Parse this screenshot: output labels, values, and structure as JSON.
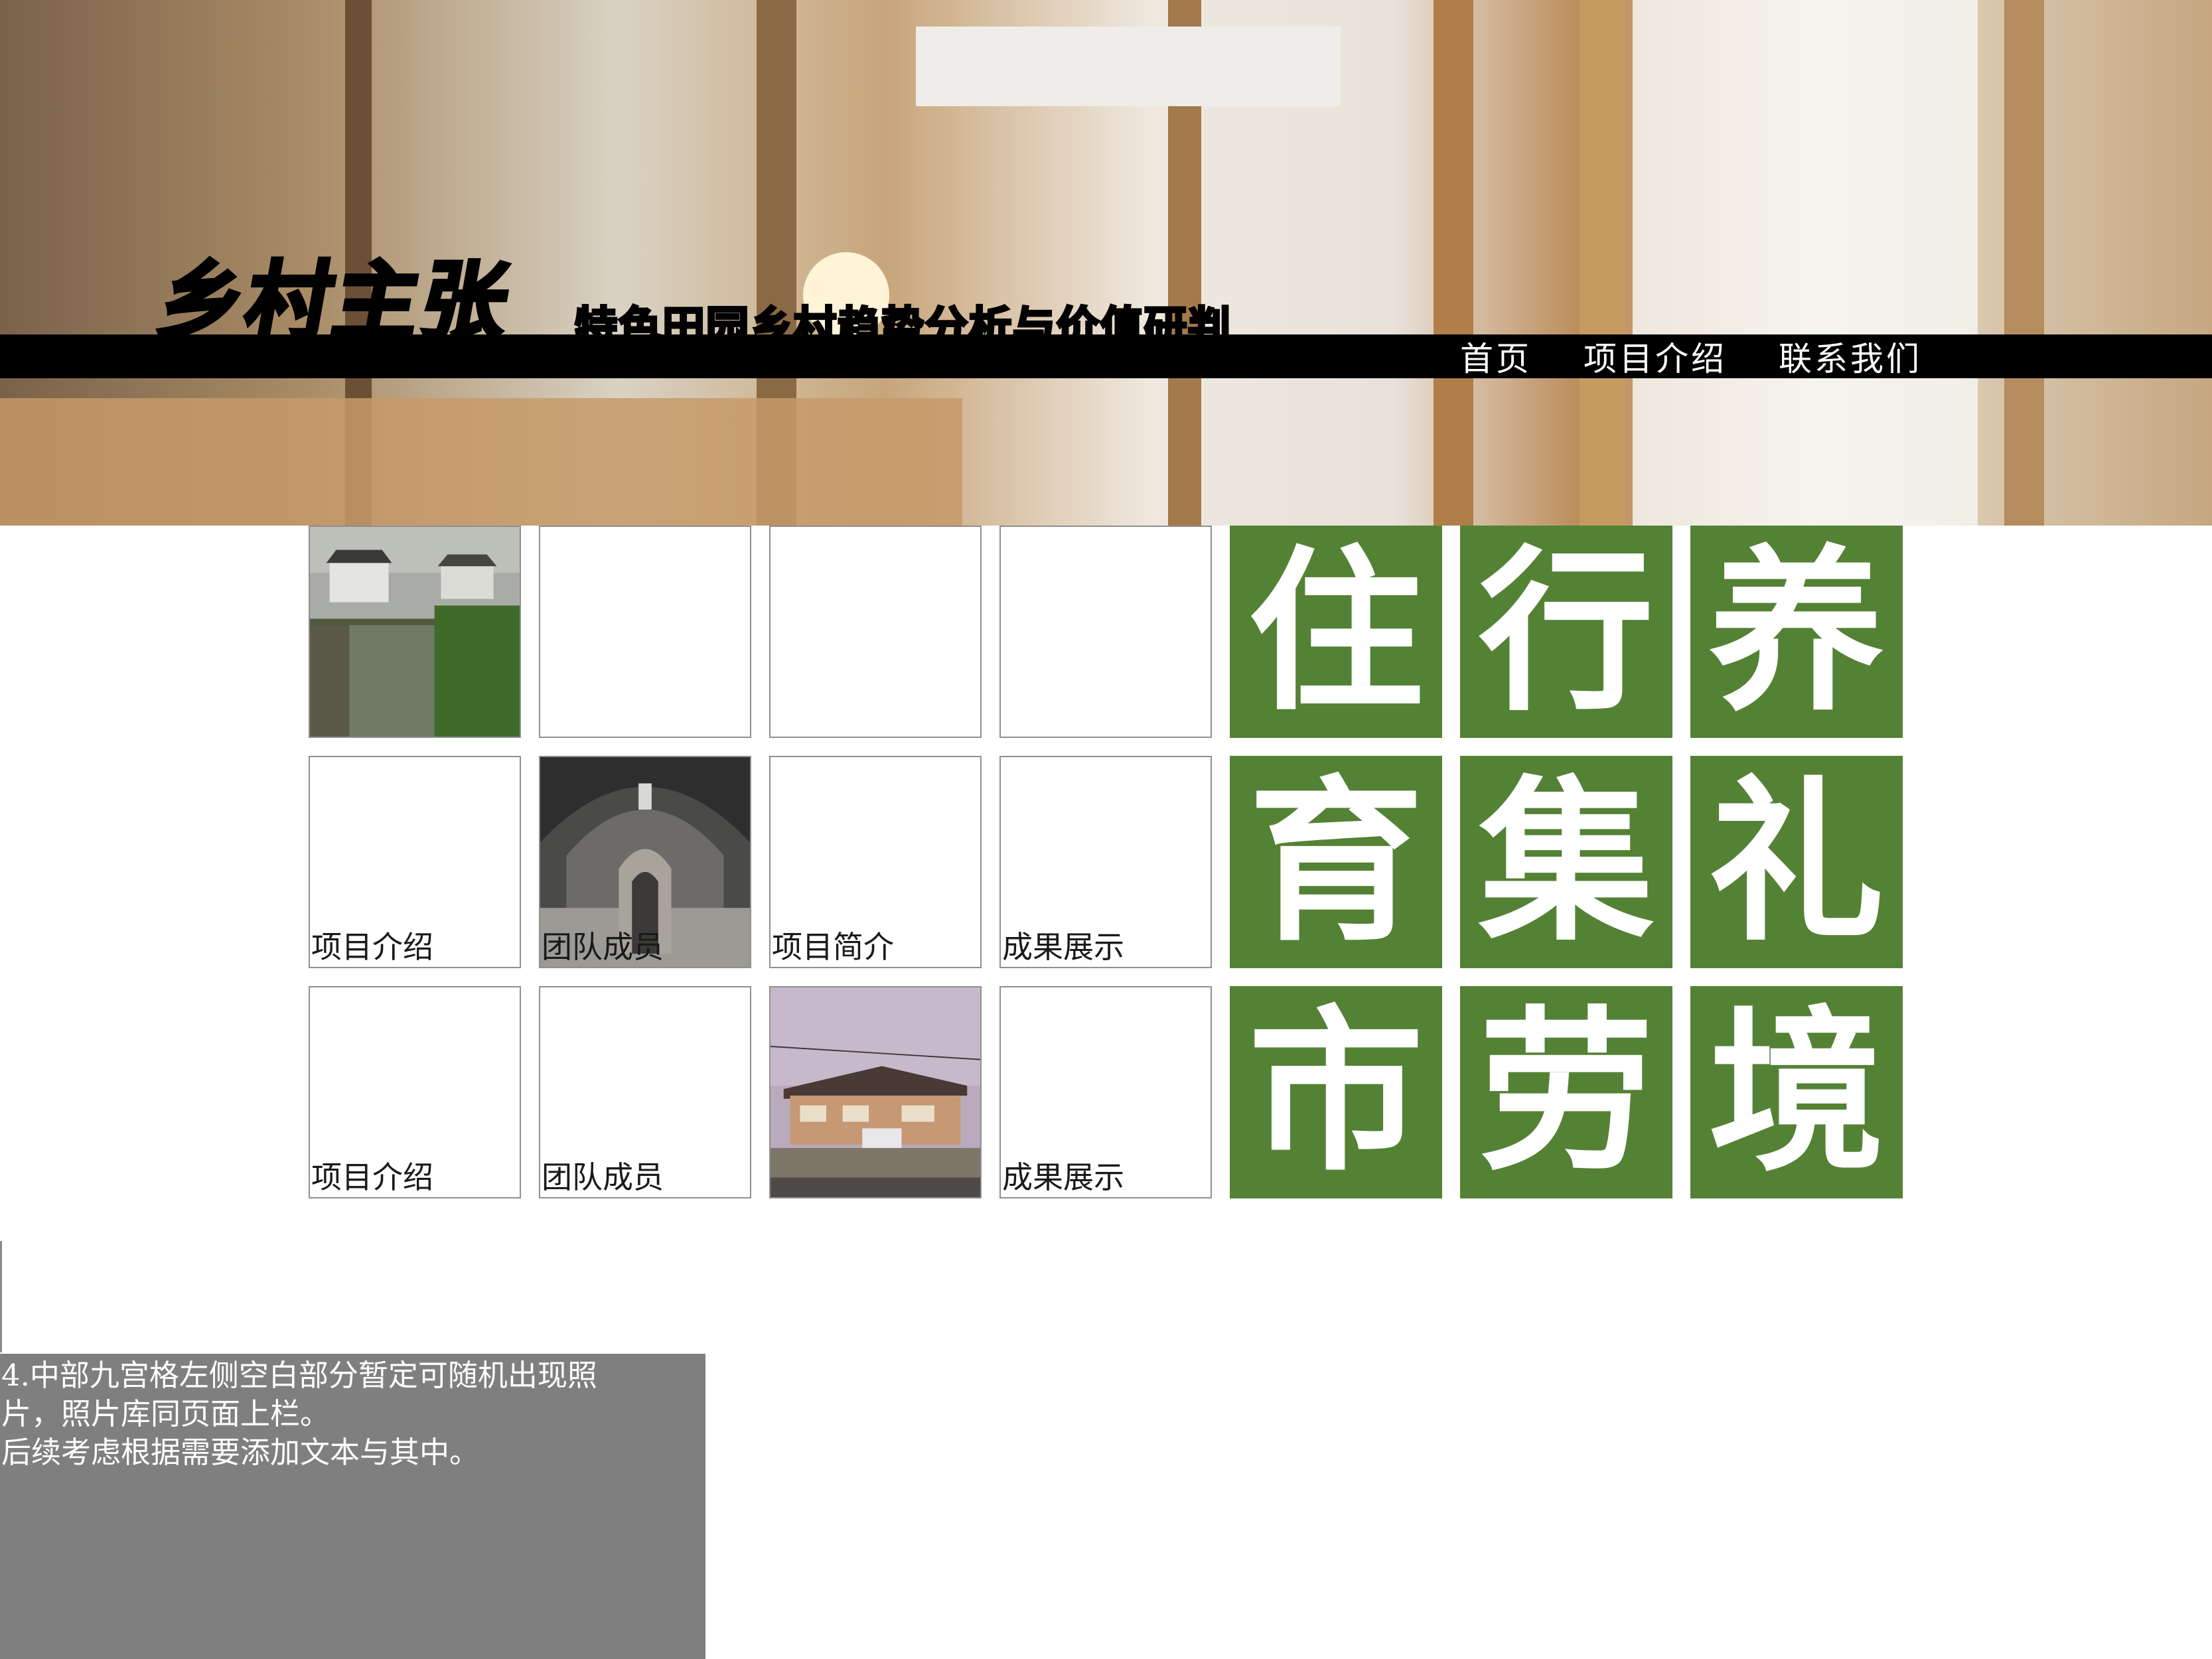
{
  "header": {
    "logo_main": "乡村主张",
    "logo_sub": "特色田园乡村趋势分析与价值研判",
    "nav": [
      {
        "label": "首页"
      },
      {
        "label": "项目介绍"
      },
      {
        "label": "联系我们"
      }
    ]
  },
  "grid": {
    "rows": [
      [
        {
          "label": "",
          "image": "canal-village-photo"
        },
        {
          "label": "",
          "image": ""
        },
        {
          "label": "",
          "image": ""
        },
        {
          "label": "",
          "image": ""
        }
      ],
      [
        {
          "label": "项目介绍",
          "image": ""
        },
        {
          "label": "团队成员",
          "image": "brick-arch-tunnel-photo"
        },
        {
          "label": "项目简介",
          "image": ""
        },
        {
          "label": "成果展示",
          "image": ""
        }
      ],
      [
        {
          "label": "项目介绍",
          "image": ""
        },
        {
          "label": "团队成员",
          "image": ""
        },
        {
          "label": "",
          "image": "rural-house-photo"
        },
        {
          "label": "成果展示",
          "image": ""
        }
      ]
    ]
  },
  "themes": {
    "color": "#548235",
    "chars": [
      "住",
      "行",
      "养",
      "育",
      "集",
      "礼",
      "市",
      "劳",
      "境"
    ]
  },
  "note": {
    "lines": [
      "4.中部九宫格左侧空白部分暂定可随机出现照",
      "片，照片库同页面上栏。",
      "后续考虑根据需要添加文本与其中。"
    ]
  }
}
